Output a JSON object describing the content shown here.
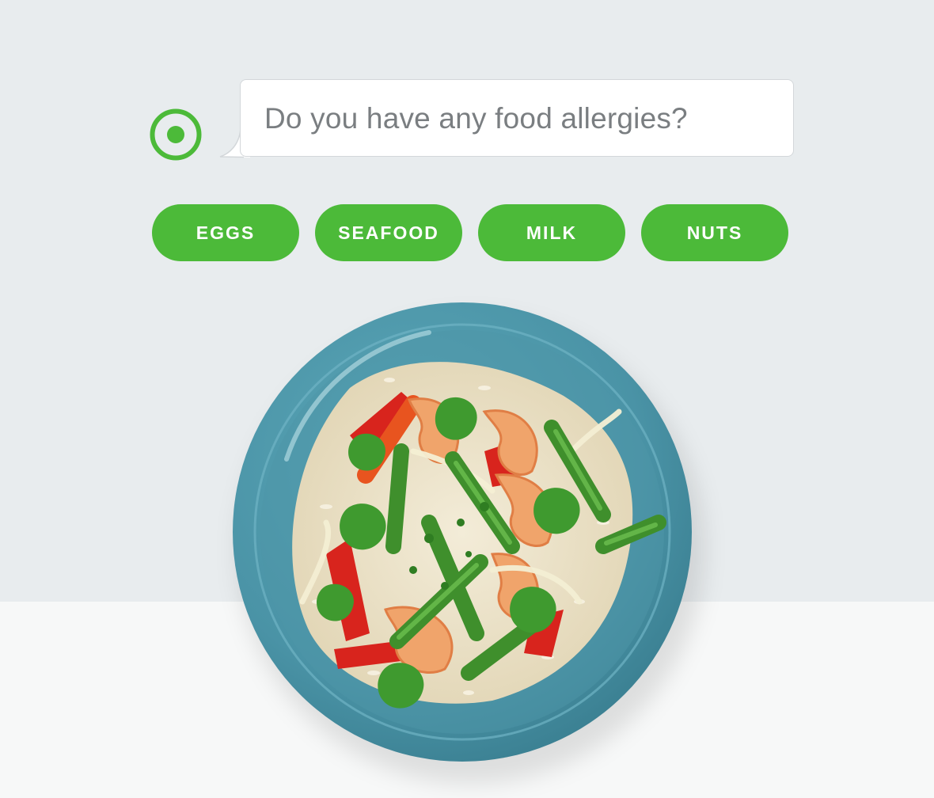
{
  "question": {
    "text": "Do you have any food allergies?"
  },
  "options": [
    {
      "label": "EGGS"
    },
    {
      "label": "SEAFOOD"
    },
    {
      "label": "MILK"
    },
    {
      "label": "NUTS"
    }
  ],
  "icons": {
    "bot": "radio-target-icon"
  },
  "colors": {
    "accent": "#4cba39",
    "background_upper": "#e8ecee",
    "background_lower": "#f7f8f8",
    "plate": "#4a93a6",
    "question_text": "#7a7e81"
  }
}
